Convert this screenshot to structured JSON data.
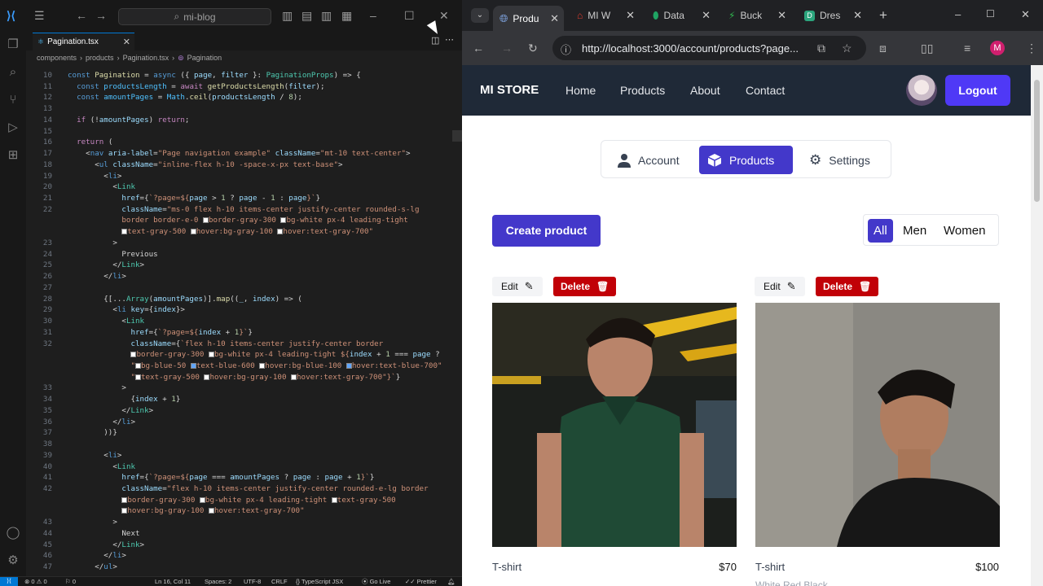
{
  "vscode": {
    "search": "mi-blog",
    "tab": "Pagination.tsx",
    "breadcrumb": [
      "components",
      "products",
      "Pagination.tsx",
      "Pagination"
    ],
    "lines": [
      {
        "n": "10",
        "html": "<span class=k>const</span> <span class=f>Pagination</span> <span class=p>=</span> <span class=k>async</span> <span class=p>({ </span>page<span class=p>, </span>filter <span class=p>}: </span><span class=t>PaginationProps</span><span class=p>) => {</span>"
      },
      {
        "n": "11",
        "html": "  <span class=k>const</span> <span class=v>productsLength</span> <span class=p>=</span> <span class=kw>await</span> <span class=f>getProductsLength</span><span class=p>(</span>filter<span class=p>);</span>"
      },
      {
        "n": "12",
        "html": "  <span class=k>const</span> <span class=v>amountPages</span> <span class=p>=</span> <span class=v>Math</span><span class=p>.</span><span class=f>ceil</span><span class=p>(</span>productsLength <span class=p>/ </span><span style='color:#b5cea8'>8</span><span class=p>);</span>"
      },
      {
        "n": "13",
        "html": ""
      },
      {
        "n": "14",
        "html": "  <span class=kw>if</span> <span class=p>(!</span>amountPages<span class=p>) </span><span class=kw>return</span><span class=p>;</span>"
      },
      {
        "n": "15",
        "html": ""
      },
      {
        "n": "16",
        "html": "  <span class=kw>return</span> <span class=p>(</span>"
      },
      {
        "n": "17",
        "html": "    <span class=p>&lt;</span><span class=tag>nav</span> <span class=a>aria-label</span><span class=p>=</span><span class=s>\"Page navigation example\"</span> <span class=a>className</span><span class=p>=</span><span class=s>\"mt-10 text-center\"</span><span class=p>&gt;</span>"
      },
      {
        "n": "18",
        "html": "      <span class=p>&lt;</span><span class=tag>ul</span> <span class=a>className</span><span class=p>=</span><span class=s>\"inline-flex h-10 -space-x-px text-base\"</span><span class=p>&gt;</span>"
      },
      {
        "n": "19",
        "html": "        <span class=p>&lt;</span><span class=tag>li</span><span class=p>&gt;</span>"
      },
      {
        "n": "20",
        "html": "          <span class=p>&lt;</span><span class=t>Link</span>"
      },
      {
        "n": "21",
        "html": "            <span class=a>href</span><span class=p>={</span><span class=s>`?page=${</span>page <span class=p>&gt;</span> <span style='color:#b5cea8'>1</span> <span class=p>?</span> page <span class=p>-</span> <span style='color:#b5cea8'>1</span> <span class=p>:</span> page<span class=s>}`</span><span class=p>}</span>"
      },
      {
        "n": "22",
        "html": "            <span class=a>className</span><span class=p>=</span><span class=s>\"ms-0 flex h-10 items-center justify-center rounded-s-lg</span>"
      },
      {
        "n": "",
        "html": "<span class=s>            border border-e-0 </span><span class=sq></span><span class=s>border-gray-300 </span><span class=sq></span><span class=s>bg-white px-4 leading-tight</span>"
      },
      {
        "n": "",
        "html": "<span class=s>            </span><span class=sq></span><span class=s>text-gray-500 </span><span class=sq></span><span class=s>hover:bg-gray-100 </span><span class=sq></span><span class=s>hover:text-gray-700\"</span>"
      },
      {
        "n": "23",
        "html": "          <span class=p>&gt;</span>"
      },
      {
        "n": "24",
        "html": "            <span class=p>Previous</span>"
      },
      {
        "n": "25",
        "html": "          <span class=p>&lt;/</span><span class=t>Link</span><span class=p>&gt;</span>"
      },
      {
        "n": "26",
        "html": "        <span class=p>&lt;/</span><span class=tag>li</span><span class=p>&gt;</span>"
      },
      {
        "n": "27",
        "html": ""
      },
      {
        "n": "28",
        "html": "        <span class=p>{[...</span><span class=t>Array</span><span class=p>(</span>amountPages<span class=p>)].</span><span class=f>map</span><span class=p>((</span>_<span class=p>, </span>index<span class=p>) =&gt; (</span>"
      },
      {
        "n": "29",
        "html": "          <span class=p>&lt;</span><span class=tag>li</span> <span class=a>key</span><span class=p>={</span>index<span class=p>}&gt;</span>"
      },
      {
        "n": "30",
        "html": "            <span class=p>&lt;</span><span class=t>Link</span>"
      },
      {
        "n": "31",
        "html": "              <span class=a>href</span><span class=p>={</span><span class=s>`?page=${</span>index <span class=p>+</span> <span style='color:#b5cea8'>1</span><span class=s>}`</span><span class=p>}</span>"
      },
      {
        "n": "32",
        "html": "              <span class=a>className</span><span class=p>={</span><span class=s>`flex h-10 items-center justify-center border</span>"
      },
      {
        "n": "",
        "html": "<span class=s>              </span><span class=sq></span><span class=s>border-gray-300 </span><span class=sq></span><span class=s>bg-white px-4 leading-tight ${</span>index <span class=p>+</span> <span style='color:#b5cea8'>1</span> <span class=p>===</span> page <span class=p>?</span>"
      },
      {
        "n": "",
        "html": "<span class=s>              \"</span><span class='sq'></span><span class=s>bg-blue-50 </span><span class='sq sqb'></span><span class=s>text-blue-600 </span><span class=sq></span><span class=s>hover:bg-blue-100 </span><span class='sq sqb'></span><span class=s>hover:text-blue-700\"</span>"
      },
      {
        "n": "",
        "html": "<span class=s>              \"</span><span class=sq></span><span class=s>text-gray-500 </span><span class=sq></span><span class=s>hover:bg-gray-100 </span><span class=sq></span><span class=s>hover:text-gray-700\"}`</span><span class=p>}</span>"
      },
      {
        "n": "33",
        "html": "            <span class=p>&gt;</span>"
      },
      {
        "n": "34",
        "html": "              <span class=p>{</span>index <span class=p>+</span> <span style='color:#b5cea8'>1</span><span class=p>}</span>"
      },
      {
        "n": "35",
        "html": "            <span class=p>&lt;/</span><span class=t>Link</span><span class=p>&gt;</span>"
      },
      {
        "n": "36",
        "html": "          <span class=p>&lt;/</span><span class=tag>li</span><span class=p>&gt;</span>"
      },
      {
        "n": "37",
        "html": "        <span class=p>))}</span>"
      },
      {
        "n": "38",
        "html": ""
      },
      {
        "n": "39",
        "html": "        <span class=p>&lt;</span><span class=tag>li</span><span class=p>&gt;</span>"
      },
      {
        "n": "40",
        "html": "          <span class=p>&lt;</span><span class=t>Link</span>"
      },
      {
        "n": "41",
        "html": "            <span class=a>href</span><span class=p>={</span><span class=s>`?page=${</span>page <span class=p>===</span> amountPages <span class=p>?</span> page <span class=p>:</span> page <span class=p>+</span> <span style='color:#b5cea8'>1</span><span class=s>}`</span><span class=p>}</span>"
      },
      {
        "n": "42",
        "html": "            <span class=a>className</span><span class=p>=</span><span class=s>\"flex h-10 items-center justify-center rounded-e-lg border</span>"
      },
      {
        "n": "",
        "html": "<span class=s>            </span><span class=sq></span><span class=s>border-gray-300 </span><span class=sq></span><span class=s>bg-white px-4 leading-tight </span><span class=sq></span><span class=s>text-gray-500</span>"
      },
      {
        "n": "",
        "html": "<span class=s>            </span><span class=sq></span><span class=s>hover:bg-gray-100 </span><span class=sq></span><span class=s>hover:text-gray-700\"</span>"
      },
      {
        "n": "43",
        "html": "          <span class=p>&gt;</span>"
      },
      {
        "n": "44",
        "html": "            <span class=p>Next</span>"
      },
      {
        "n": "45",
        "html": "          <span class=p>&lt;/</span><span class=t>Link</span><span class=p>&gt;</span>"
      },
      {
        "n": "46",
        "html": "        <span class=p>&lt;/</span><span class=tag>li</span><span class=p>&gt;</span>"
      },
      {
        "n": "47",
        "html": "      <span class=p>&lt;/</span><span class=tag>ul</span><span class=p>&gt;</span>"
      }
    ],
    "status": {
      "errors": "0",
      "warnings": "0",
      "ports": "0",
      "position": "Ln 16, Col 11",
      "spaces": "Spaces: 2",
      "encoding": "UTF-8",
      "eol": "CRLF",
      "language": "TypeScript JSX",
      "golive": "Go Live",
      "prettier": "Prettier"
    }
  },
  "browser": {
    "tabs": [
      {
        "label": "Produ",
        "color": "#8ab4f8"
      },
      {
        "label": "MI W",
        "color": "#e33b2e"
      },
      {
        "label": "Data",
        "color": "#1fa463"
      },
      {
        "label": "Buck",
        "color": "#30b54e"
      },
      {
        "label": "Dres",
        "color": "#2ba57d"
      }
    ],
    "url": "http://localhost:3000/account/products?page...",
    "profile": "M"
  },
  "site": {
    "brand": "MI STORE",
    "nav": [
      "Home",
      "Products",
      "About",
      "Contact"
    ],
    "logout": "Logout",
    "account_tabs": [
      "Account",
      "Products",
      "Settings"
    ],
    "create": "Create product",
    "filters": [
      "All",
      "Men",
      "Women"
    ],
    "edit_label": "Edit",
    "delete_label": "Delete",
    "products": [
      {
        "name": "T-shirt",
        "price": "$70",
        "colors": ""
      },
      {
        "name": "T-shirt",
        "price": "$100",
        "colors": "White Red Black"
      }
    ]
  }
}
